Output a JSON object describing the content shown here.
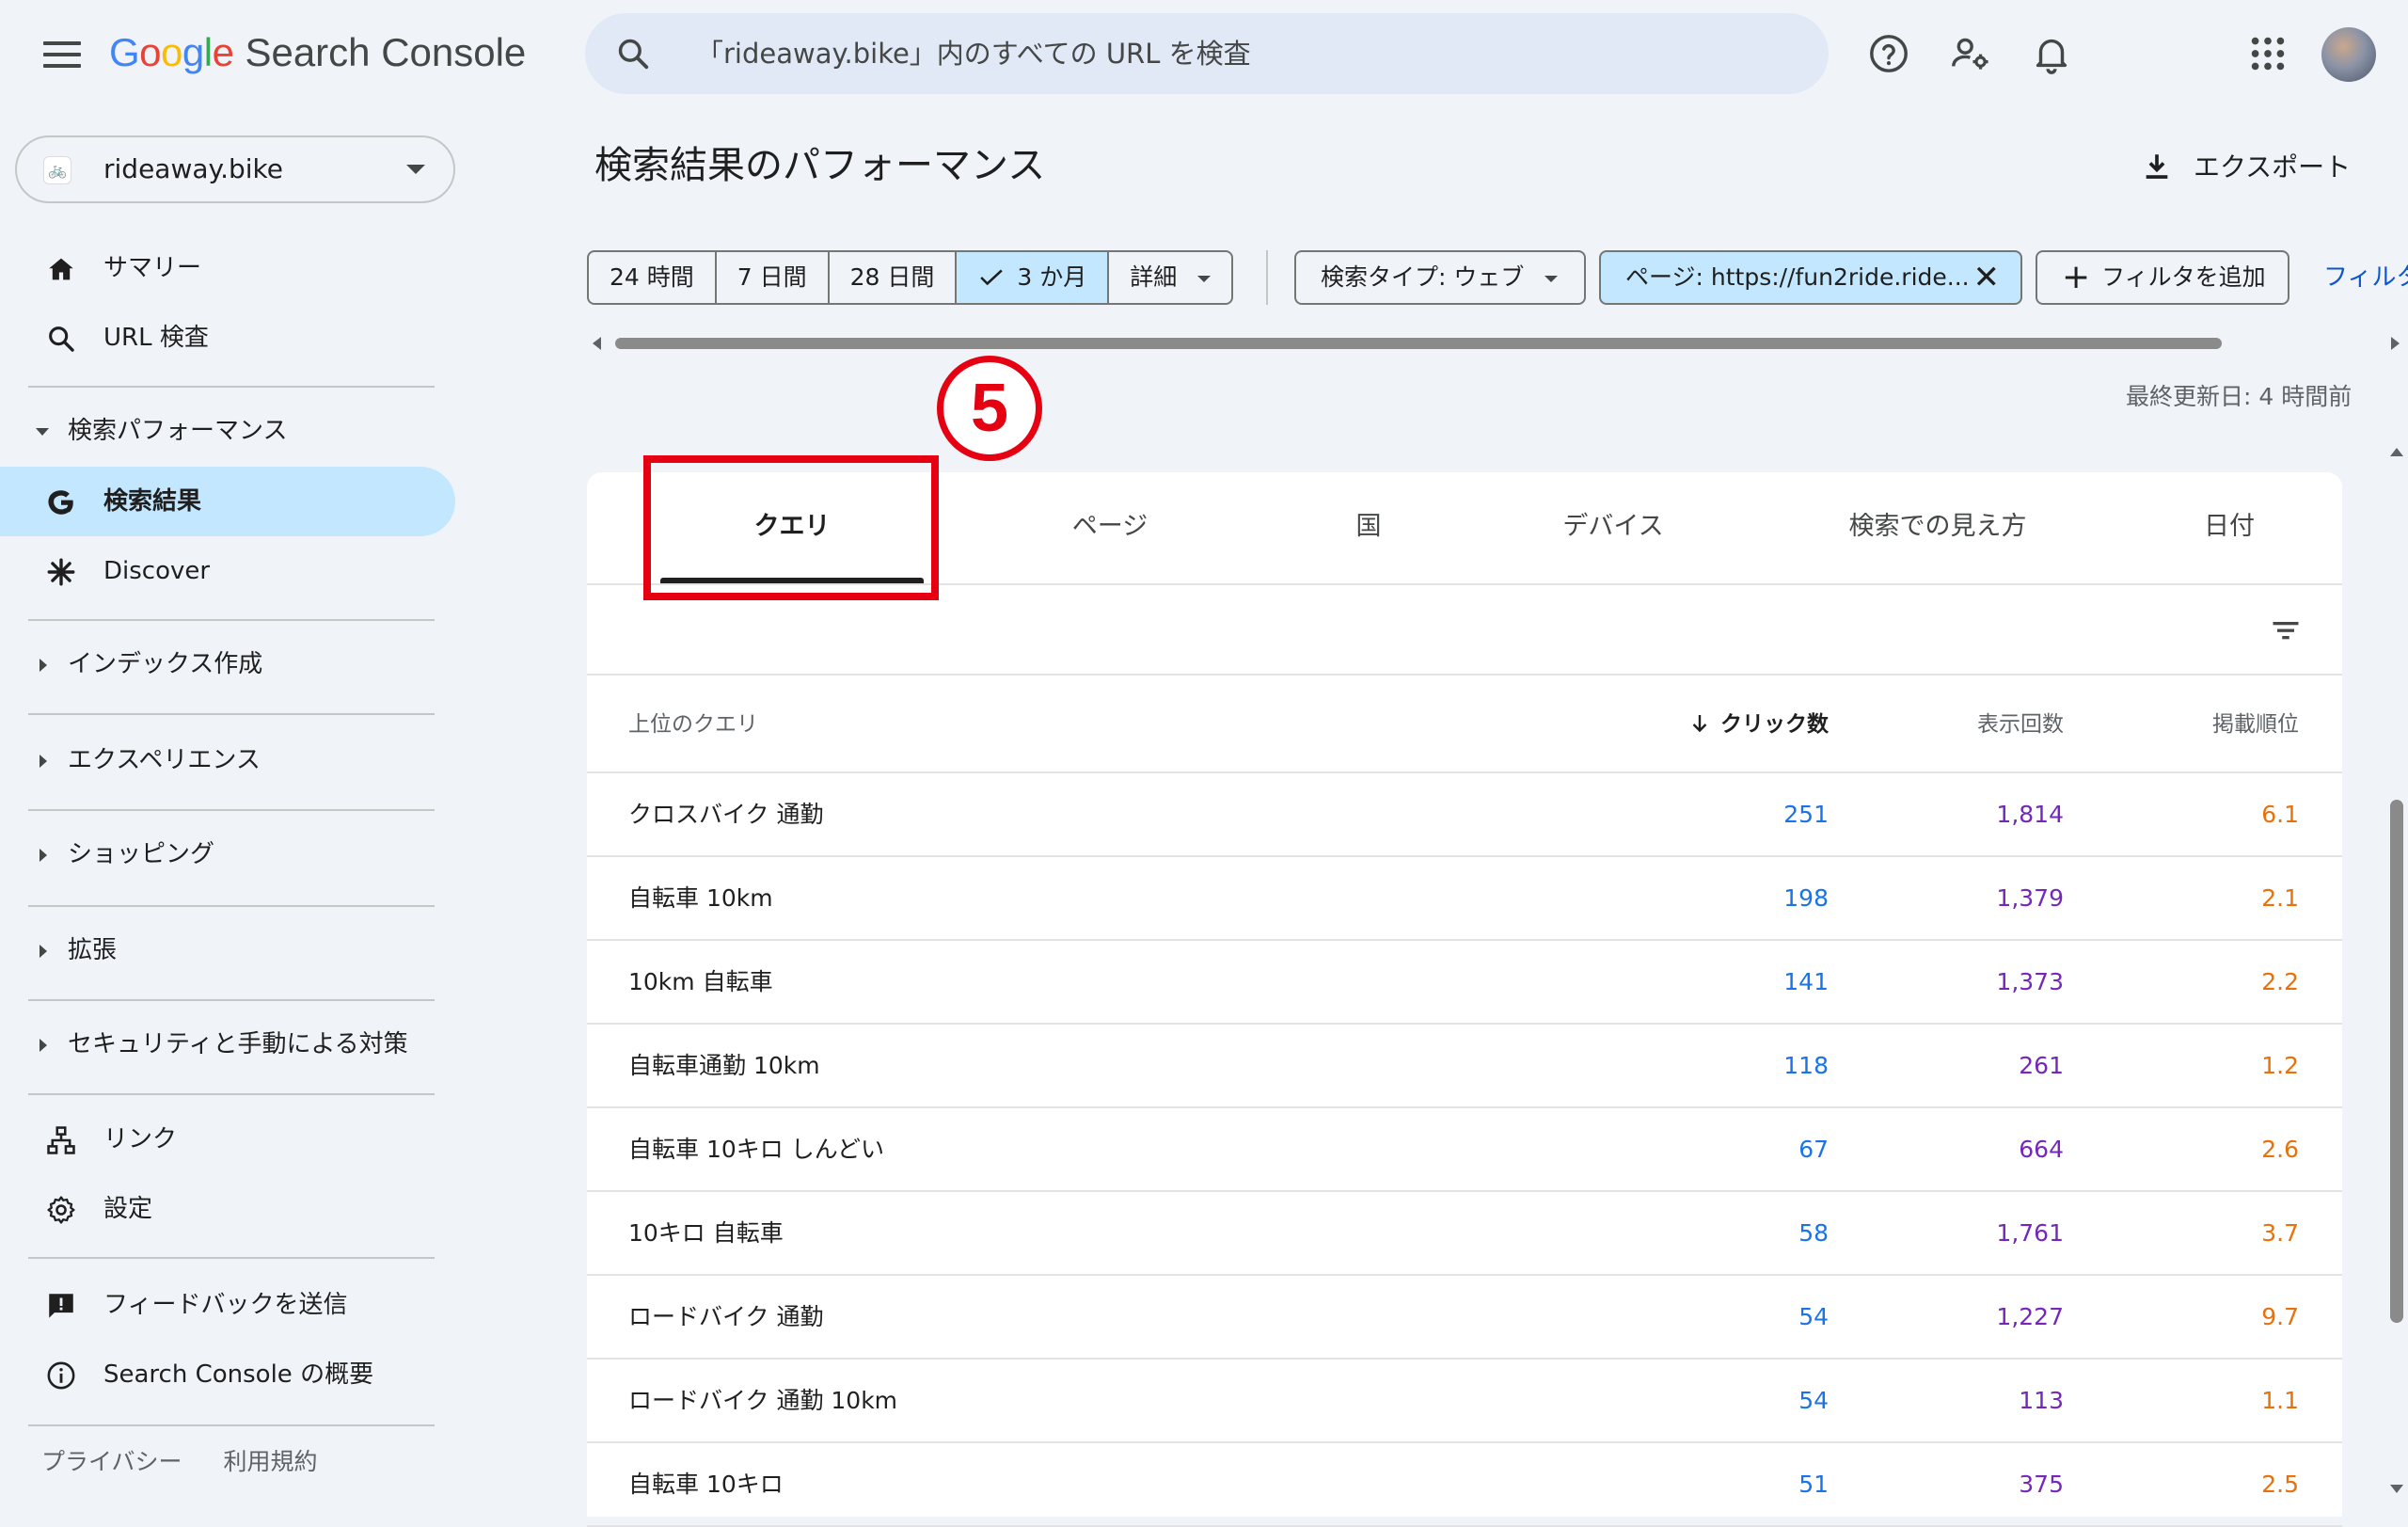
{
  "app": {
    "brand_google": "Google",
    "brand_product": "Search Console"
  },
  "search": {
    "placeholder": "「rideaway.bike」内のすべての URL を検査"
  },
  "property": {
    "name": "rideaway.bike"
  },
  "sidebar": {
    "items": [
      {
        "label": "サマリー",
        "icon": "home-icon"
      },
      {
        "label": "URL 検査",
        "icon": "search-icon"
      },
      {
        "label": "検索パフォーマンス",
        "type": "section-expanded"
      },
      {
        "label": "検索結果",
        "icon": "google-g-icon",
        "active": true
      },
      {
        "label": "Discover",
        "icon": "asterisk-icon"
      },
      {
        "label": "インデックス作成",
        "type": "section"
      },
      {
        "label": "エクスペリエンス",
        "type": "section"
      },
      {
        "label": "ショッピング",
        "type": "section"
      },
      {
        "label": "拡張",
        "type": "section"
      },
      {
        "label": "セキュリティと手動による対策",
        "type": "section"
      },
      {
        "label": "リンク",
        "icon": "links-icon"
      },
      {
        "label": "設定",
        "icon": "gear-icon"
      },
      {
        "label": "フィードバックを送信",
        "icon": "feedback-icon"
      },
      {
        "label": "Search Console の概要",
        "icon": "info-icon"
      }
    ],
    "footer": [
      "プライバシー",
      "利用規約"
    ]
  },
  "main": {
    "title": "検索結果のパフォーマンス",
    "export_label": "エクスポート",
    "date_ranges": [
      "24 時間",
      "7 日間",
      "28 日間",
      "3 か月",
      "詳細"
    ],
    "selected_date_range": "3 か月",
    "chips": {
      "search_type": "検索タイプ: ウェブ",
      "page_filter": "ページ: https://fun2ride.ride...",
      "add_filter": "フィルタを追加",
      "filter_link": "フィルタ"
    },
    "last_updated": "最終更新日: 4 時間前",
    "step_marker": "5",
    "tabs": [
      "クエリ",
      "ページ",
      "国",
      "デバイス",
      "検索での見え方",
      "日付"
    ],
    "active_tab": "クエリ",
    "table": {
      "headers": {
        "query": "上位のクエリ",
        "clicks": "クリック数",
        "impressions": "表示回数",
        "position": "掲載順位"
      },
      "rows": [
        {
          "query": "クロスバイク 通勤",
          "clicks": "251",
          "impressions": "1,814",
          "position": "6.1"
        },
        {
          "query": "自転車 10km",
          "clicks": "198",
          "impressions": "1,379",
          "position": "2.1"
        },
        {
          "query": "10km 自転車",
          "clicks": "141",
          "impressions": "1,373",
          "position": "2.2"
        },
        {
          "query": "自転車通勤 10km",
          "clicks": "118",
          "impressions": "261",
          "position": "1.2"
        },
        {
          "query": "自転車 10キロ しんどい",
          "clicks": "67",
          "impressions": "664",
          "position": "2.6"
        },
        {
          "query": "10キロ 自転車",
          "clicks": "58",
          "impressions": "1,761",
          "position": "3.7"
        },
        {
          "query": "ロードバイク 通勤",
          "clicks": "54",
          "impressions": "1,227",
          "position": "9.7"
        },
        {
          "query": "ロードバイク 通勤 10km",
          "clicks": "54",
          "impressions": "113",
          "position": "1.1"
        },
        {
          "query": "自転車 10キロ",
          "clicks": "51",
          "impressions": "375",
          "position": "2.5"
        }
      ]
    }
  },
  "colors": {
    "accent_blue": "#0b57d0",
    "selected_bg": "#c2e7ff",
    "clicks": "#1a73e8",
    "impressions": "#7627bb",
    "position": "#e8710a",
    "annotation_red": "#e50012"
  }
}
